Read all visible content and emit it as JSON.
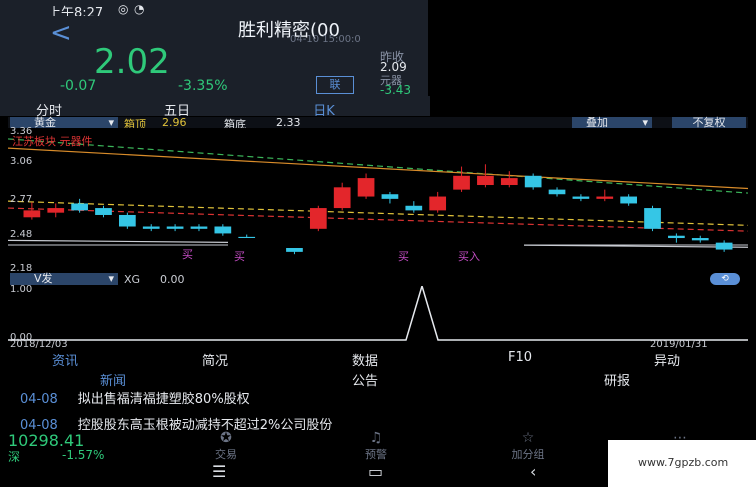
{
  "status": {
    "time": "上午8:27"
  },
  "header": {
    "back": "<",
    "stock_name": "胜利精密(00",
    "date": "04-10 15:00:0",
    "price": "2.02",
    "change": "-0.07",
    "change_pct": "-3.35%",
    "badge": "联",
    "side_label1": "昨收",
    "side_val1": "2.09",
    "side_label2": "元器",
    "side_val2": "-3.43"
  },
  "tabs": [
    "分时",
    "五日",
    "日K",
    ""
  ],
  "chart_bar": {
    "dropdown_left": "黄金",
    "box_top_label": "箱顶",
    "box_top": "2.96",
    "box_bottom_label": "箱底",
    "box_bottom": "2.33",
    "overlay": "叠加",
    "adjust": "不复权"
  },
  "chart": {
    "annotation_red": "江苏板块 元器件",
    "bottom_labels": [
      "买",
      "买",
      "买"
    ],
    "buy_text": "买入",
    "y_ticks": [
      "3.36",
      "3.06",
      "2.77",
      "2.48",
      "2.18"
    ]
  },
  "volume_bar": {
    "dropdown": "V发",
    "indicator": "XG",
    "value": "0.00",
    "y_top": "1.00",
    "y_bottom": "0.00"
  },
  "x_axis": {
    "start": "2018/12/03",
    "end": "2019/01/31"
  },
  "bottom_tabs": [
    "资讯",
    "简况",
    "数据",
    "F10",
    "异动"
  ],
  "sub_tabs": [
    "新闻",
    "公告",
    "研报"
  ],
  "news": [
    {
      "date": "04-08",
      "title": "拟出售福清福捷塑胶80%股权"
    },
    {
      "date": "04-08",
      "title": "控股股东高玉根被动减持不超过2%公司股份"
    }
  ],
  "footer": {
    "index_value": "10298.41",
    "index_name": "深",
    "index_pct": "-1.57%",
    "items": [
      "交易",
      "预警",
      "加分组",
      ""
    ]
  },
  "watermark": "www.7gpzb.com",
  "chart_data": {
    "type": "candlestick",
    "y_range": [
      2.18,
      3.36
    ],
    "x_range": [
      "2018/12/03",
      "2019/01/31"
    ],
    "candles": [
      {
        "o": 2.68,
        "c": 2.62,
        "h": 2.75,
        "l": 2.6,
        "up": true
      },
      {
        "o": 2.7,
        "c": 2.66,
        "h": 2.74,
        "l": 2.62,
        "up": true
      },
      {
        "o": 2.74,
        "c": 2.68,
        "h": 2.78,
        "l": 2.66,
        "up": false
      },
      {
        "o": 2.7,
        "c": 2.64,
        "h": 2.72,
        "l": 2.62,
        "up": false
      },
      {
        "o": 2.64,
        "c": 2.54,
        "h": 2.66,
        "l": 2.52,
        "up": false
      },
      {
        "o": 2.54,
        "c": 2.52,
        "h": 2.56,
        "l": 2.5,
        "up": false
      },
      {
        "o": 2.54,
        "c": 2.52,
        "h": 2.56,
        "l": 2.5,
        "up": false
      },
      {
        "o": 2.54,
        "c": 2.52,
        "h": 2.56,
        "l": 2.5,
        "up": false
      },
      {
        "o": 2.54,
        "c": 2.48,
        "h": 2.56,
        "l": 2.46,
        "up": false
      },
      {
        "o": 2.45,
        "c": 2.42,
        "h": 2.47,
        "l": 2.4,
        "up": false
      },
      {
        "o": 2.42,
        "c": 2.41,
        "h": 2.44,
        "l": 2.4,
        "up": false
      },
      {
        "o": 2.36,
        "c": 2.32,
        "h": 2.38,
        "l": 2.3,
        "up": false
      },
      {
        "o": 2.52,
        "c": 2.7,
        "h": 2.72,
        "l": 2.5,
        "up": true
      },
      {
        "o": 2.7,
        "c": 2.88,
        "h": 2.92,
        "l": 2.68,
        "up": true
      },
      {
        "o": 2.8,
        "c": 2.96,
        "h": 3.0,
        "l": 2.78,
        "up": true
      },
      {
        "o": 2.82,
        "c": 2.78,
        "h": 2.84,
        "l": 2.74,
        "up": false
      },
      {
        "o": 2.72,
        "c": 2.68,
        "h": 2.76,
        "l": 2.66,
        "up": false
      },
      {
        "o": 2.68,
        "c": 2.8,
        "h": 2.84,
        "l": 2.66,
        "up": true
      },
      {
        "o": 2.86,
        "c": 2.98,
        "h": 3.06,
        "l": 2.84,
        "up": true
      },
      {
        "o": 2.98,
        "c": 2.9,
        "h": 3.08,
        "l": 2.88,
        "up": true
      },
      {
        "o": 2.9,
        "c": 2.96,
        "h": 3.02,
        "l": 2.88,
        "up": true
      },
      {
        "o": 2.98,
        "c": 2.88,
        "h": 3.0,
        "l": 2.86,
        "up": false
      },
      {
        "o": 2.86,
        "c": 2.82,
        "h": 2.88,
        "l": 2.8,
        "up": false
      },
      {
        "o": 2.8,
        "c": 2.78,
        "h": 2.82,
        "l": 2.76,
        "up": false
      },
      {
        "o": 2.78,
        "c": 2.8,
        "h": 2.86,
        "l": 2.76,
        "up": true
      },
      {
        "o": 2.8,
        "c": 2.74,
        "h": 2.82,
        "l": 2.72,
        "up": false
      },
      {
        "o": 2.7,
        "c": 2.52,
        "h": 2.72,
        "l": 2.5,
        "up": false
      },
      {
        "o": 2.46,
        "c": 2.44,
        "h": 2.48,
        "l": 2.4,
        "up": false
      },
      {
        "o": 2.44,
        "c": 2.42,
        "h": 2.46,
        "l": 2.4,
        "up": false
      },
      {
        "o": 2.4,
        "c": 2.34,
        "h": 2.42,
        "l": 2.32,
        "up": false
      }
    ],
    "lines": [
      {
        "name": "yellow-dash",
        "color": "#e0c23a",
        "start": 2.76,
        "end": 2.55
      },
      {
        "name": "red-dash",
        "color": "#d33",
        "start": 2.7,
        "end": 2.5
      },
      {
        "name": "green-dash",
        "color": "#3bb65a",
        "start": 3.3,
        "end": 2.83
      },
      {
        "name": "orange-ma",
        "color": "#d98c2a",
        "start": 3.22,
        "end": 2.87
      },
      {
        "name": "white-level",
        "color": "#c9ccd3",
        "start": 2.42,
        "end": 2.36
      }
    ]
  }
}
